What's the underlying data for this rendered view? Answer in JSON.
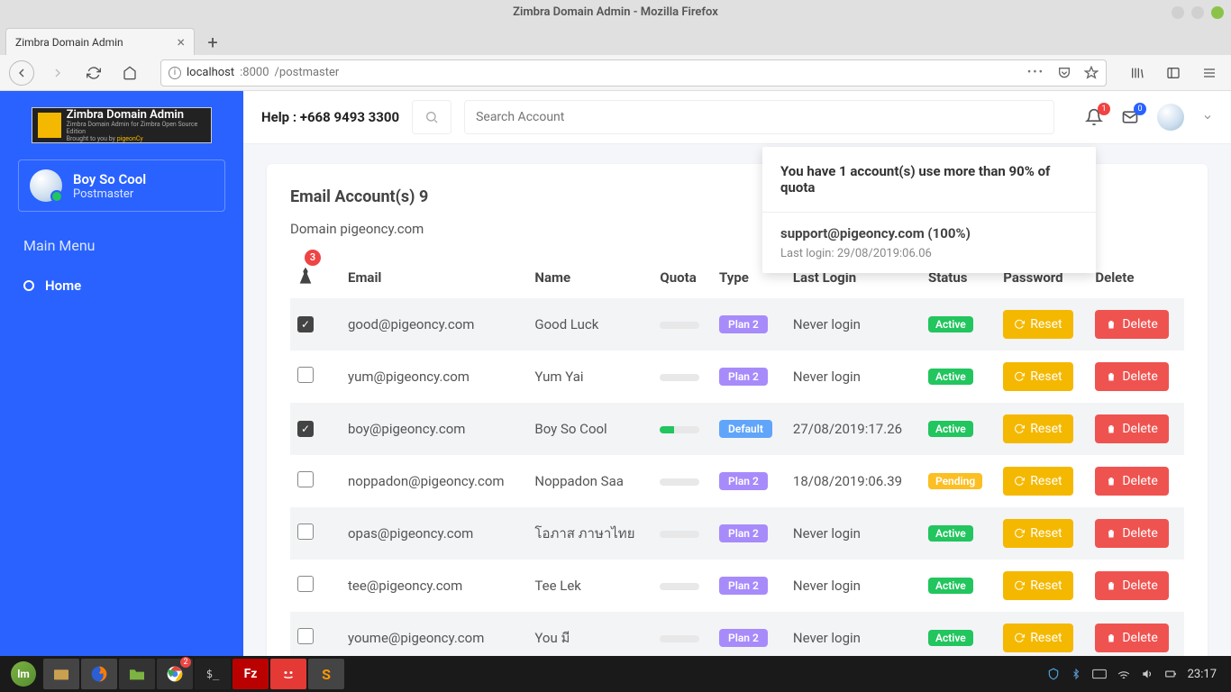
{
  "os": {
    "title": "Zimbra Domain Admin - Mozilla Firefox"
  },
  "browser": {
    "tab_title": "Zimbra Domain Admin",
    "url_host": "localhost",
    "url_port": ":8000",
    "url_path": "/postmaster"
  },
  "sidebar": {
    "logo_title": "Zimbra Domain Admin",
    "logo_sub_prefix": "Zimbra Domain Admin for Zimbra Open Source Edition",
    "logo_sub2_prefix": "Brought to you by ",
    "logo_sub2_link": "pigeonCy",
    "user_name": "Boy So Cool",
    "user_role": "Postmaster",
    "menu_heading": "Main Menu",
    "home_label": "Home"
  },
  "header": {
    "help_text": "Help : +668 9493 3300",
    "search_placeholder": "Search Account",
    "bell_badge": "1",
    "mail_badge": "0"
  },
  "notification": {
    "heading": "You have 1 account(s) use more than 90% of quota",
    "account": "support@pigeoncy.com (100%)",
    "last_login_label": "Last login: 29/08/2019:06.06"
  },
  "content": {
    "title_prefix": "Email Account(s) ",
    "title_count": "9",
    "domain_prefix": "Domain ",
    "domain": "pigeoncy.com",
    "badge_count": "3",
    "columns": {
      "email": "Email",
      "name": "Name",
      "quota": "Quota",
      "type": "Type",
      "last_login": "Last Login",
      "status": "Status",
      "password": "Password",
      "delete": "Delete"
    },
    "reset_label": "Reset",
    "delete_label": "Delete",
    "rows": [
      {
        "checked": true,
        "email": "good@pigeoncy.com",
        "name": "Good Luck",
        "quota_pct": 0,
        "type": "Plan 2",
        "type_class": "pill-plan2",
        "last_login": "Never login",
        "status": "Active",
        "status_class": "st-active"
      },
      {
        "checked": false,
        "email": "yum@pigeoncy.com",
        "name": "Yum Yai",
        "quota_pct": 0,
        "type": "Plan 2",
        "type_class": "pill-plan2",
        "last_login": "Never login",
        "status": "Active",
        "status_class": "st-active"
      },
      {
        "checked": true,
        "email": "boy@pigeoncy.com",
        "name": "Boy So Cool",
        "quota_pct": 35,
        "type": "Default",
        "type_class": "pill-default",
        "last_login": "27/08/2019:17.26",
        "status": "Active",
        "status_class": "st-active"
      },
      {
        "checked": false,
        "email": "noppadon@pigeoncy.com",
        "name": "Noppadon Saa",
        "quota_pct": 0,
        "type": "Plan 2",
        "type_class": "pill-plan2",
        "last_login": "18/08/2019:06.39",
        "status": "Pending",
        "status_class": "st-pending"
      },
      {
        "checked": false,
        "email": "opas@pigeoncy.com",
        "name": "โอภาส ภาษาไทย",
        "quota_pct": 0,
        "type": "Plan 2",
        "type_class": "pill-plan2",
        "last_login": "Never login",
        "status": "Active",
        "status_class": "st-active"
      },
      {
        "checked": false,
        "email": "tee@pigeoncy.com",
        "name": "Tee Lek",
        "quota_pct": 0,
        "type": "Plan 2",
        "type_class": "pill-plan2",
        "last_login": "Never login",
        "status": "Active",
        "status_class": "st-active"
      },
      {
        "checked": false,
        "email": "youme@pigeoncy.com",
        "name": "You มี",
        "quota_pct": 0,
        "type": "Plan 2",
        "type_class": "pill-plan2",
        "last_login": "Never login",
        "status": "Active",
        "status_class": "st-active"
      }
    ]
  },
  "taskbar": {
    "clock": "23:17",
    "chrome_badge": "2"
  }
}
